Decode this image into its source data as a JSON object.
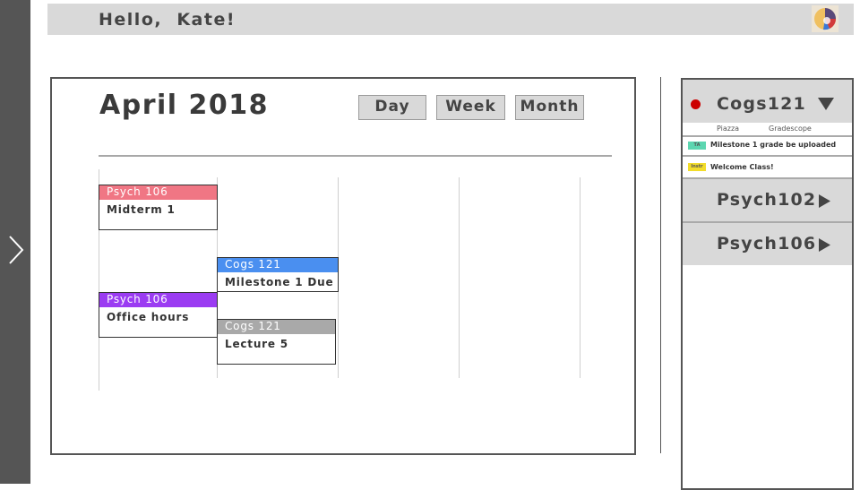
{
  "header": {
    "greeting": "Hello,  Kate!"
  },
  "calendar": {
    "month_title": "April 2018",
    "views": {
      "day": "Day",
      "week": "Week",
      "month": "Month"
    },
    "events": [
      {
        "course": "Psych 106",
        "title": "Midterm 1",
        "color": "#f07684"
      },
      {
        "course": "Cogs 121",
        "title": "Milestone 1 Due",
        "color": "#4a8ff0"
      },
      {
        "course": "Psych 106",
        "title": "Office hours",
        "color": "#9b3cf2"
      },
      {
        "course": "Cogs 121",
        "title": "Lecture 5",
        "color": "#a9a9a9"
      }
    ]
  },
  "courses": {
    "open": {
      "name": "Cogs121",
      "links": {
        "piazza": "Piazza",
        "gradescope": "Gradescope"
      },
      "announcements": [
        {
          "tag": "TA",
          "text": "Milestone 1 grade be uploaded"
        },
        {
          "tag": "Instr",
          "text": "Welcome Class!"
        }
      ]
    },
    "collapsed": [
      {
        "name": "Psych102"
      },
      {
        "name": "Psych106"
      }
    ]
  },
  "colors": {
    "status_dot": "#cc0000",
    "ta_tag": "#5cd6b0",
    "instructor_tag": "#f2dc2a"
  },
  "icons": {
    "nav": "chevron-right-icon",
    "expanded": "triangle-down-icon",
    "collapsed": "triangle-right-icon",
    "avatar": "user-avatar-icon"
  }
}
